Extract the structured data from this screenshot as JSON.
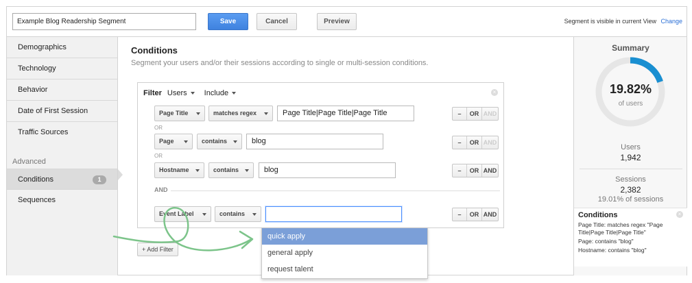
{
  "header": {
    "segment_name": "Example Blog Readership Segment",
    "save_label": "Save",
    "cancel_label": "Cancel",
    "preview_label": "Preview",
    "visibility_note": "Segment is visible in current View",
    "change_label": "Change"
  },
  "sidebar": {
    "items": [
      {
        "label": "Demographics"
      },
      {
        "label": "Technology"
      },
      {
        "label": "Behavior"
      },
      {
        "label": "Date of First Session"
      },
      {
        "label": "Traffic Sources"
      }
    ],
    "advanced_heading": "Advanced",
    "conditions_label": "Conditions",
    "conditions_count": "1",
    "sequences_label": "Sequences"
  },
  "main": {
    "title": "Conditions",
    "subtitle": "Segment your users and/or their sessions according to single or multi-session conditions.",
    "filter": {
      "filter_label": "Filter",
      "scope": "Users",
      "mode": "Include",
      "rows": [
        {
          "dimension": "Page Title",
          "operator": "matches regex",
          "value": "Page Title|Page Title|Page Title"
        },
        {
          "dimension": "Page",
          "operator": "contains",
          "value": "blog"
        },
        {
          "dimension": "Hostname",
          "operator": "contains",
          "value": "blog"
        },
        {
          "dimension": "Event Label",
          "operator": "contains",
          "value": ""
        }
      ],
      "or_label": "OR",
      "and_label": "AND",
      "minus_label": "–"
    },
    "add_filter_label": "+ Add Filter",
    "suggestions": [
      "quick apply",
      "general apply",
      "request talent"
    ]
  },
  "summary": {
    "title": "Summary",
    "percent": "19.82%",
    "percent_of": "of users",
    "percent_value": 0.1982,
    "users_label": "Users",
    "users_value": "1,942",
    "sessions_label": "Sessions",
    "sessions_value": "2,382",
    "sessions_pct": "19.01% of sessions",
    "conditions_title": "Conditions",
    "conditions_lines": [
      "Page Title: matches regex \"Page Title|Page Title|Page Title\"",
      "Page: contains \"blog\"",
      "Hostname: contains \"blog\""
    ]
  },
  "colors": {
    "accent": "#3f82df",
    "donut_fill": "#1a8fd1",
    "donut_track": "#e6e6e6",
    "highlight": "#7b9fd8",
    "annotation": "#7cc48a"
  }
}
